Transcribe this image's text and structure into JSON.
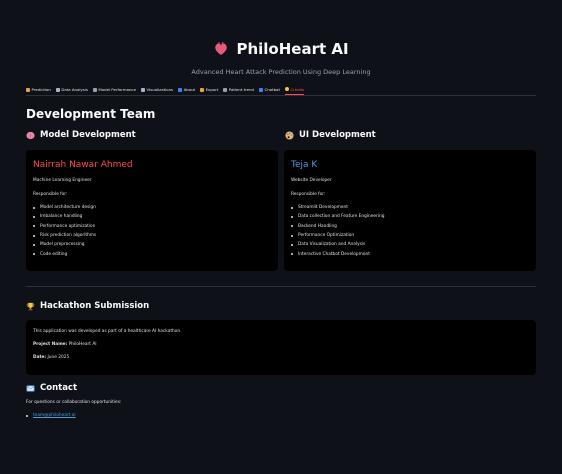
{
  "app": {
    "title": "PhiloHeart AI",
    "subtitle": "Advanced Heart Attack Prediction Using Deep Learning"
  },
  "tabs": [
    {
      "label": "Prediction",
      "icon": "target-icon",
      "color": "#e8a33d"
    },
    {
      "label": "Data Analysis",
      "icon": "chart-icon",
      "color": "#a8b3c7"
    },
    {
      "label": "Model Performance",
      "icon": "gear-icon",
      "color": "#9aa0ab"
    },
    {
      "label": "Visualizations",
      "icon": "bar-chart-icon",
      "color": "#a8b3c7"
    },
    {
      "label": "About",
      "icon": "info-icon",
      "color": "#3b82f6"
    },
    {
      "label": "Export",
      "icon": "export-icon",
      "color": "#e8a33d"
    },
    {
      "label": "Patient trend",
      "icon": "trend-icon",
      "color": "#9aa0ab"
    },
    {
      "label": "Chatbot",
      "icon": "chat-icon",
      "color": "#3b82f6"
    },
    {
      "label": "Credits",
      "icon": "star-icon",
      "color": "#f5c542",
      "active": true
    }
  ],
  "team": {
    "title": "Development Team",
    "model": {
      "heading": "Model Development",
      "name": "Nairrah Nawar Ahmed",
      "name_color": "#ff4b4b",
      "role": "Machine Learning Engineer",
      "resp_label": "Responsible for:",
      "items": [
        "Model architecture design",
        "Imbalance handling",
        "Performance optimization",
        "Risk prediction algorithms",
        "Model preprocessing",
        "Code editing"
      ]
    },
    "ui": {
      "heading": "UI Development",
      "name": "Teja K",
      "name_color": "#4d9de0",
      "role": "Website Developer",
      "resp_label": "Responsible for:",
      "items": [
        "Streamlit Development",
        "Data collection and Feature Engineering",
        "Backend Handling",
        "Performance Optimization",
        "Data Visualization and Analysis",
        "Interactive Chatbot Development"
      ]
    }
  },
  "hackathon": {
    "heading": "Hackathon Submission",
    "text": "This application was developed as part of a healthcare AI hackathon.",
    "project_label": "Project Name:",
    "project_value": "PhiloHeart AI",
    "date_label": "Date:",
    "date_value": "June 2025"
  },
  "contact": {
    "heading": "Contact",
    "text": "For questions or collaboration opportunities:",
    "email": "team@philoheart.ai"
  }
}
